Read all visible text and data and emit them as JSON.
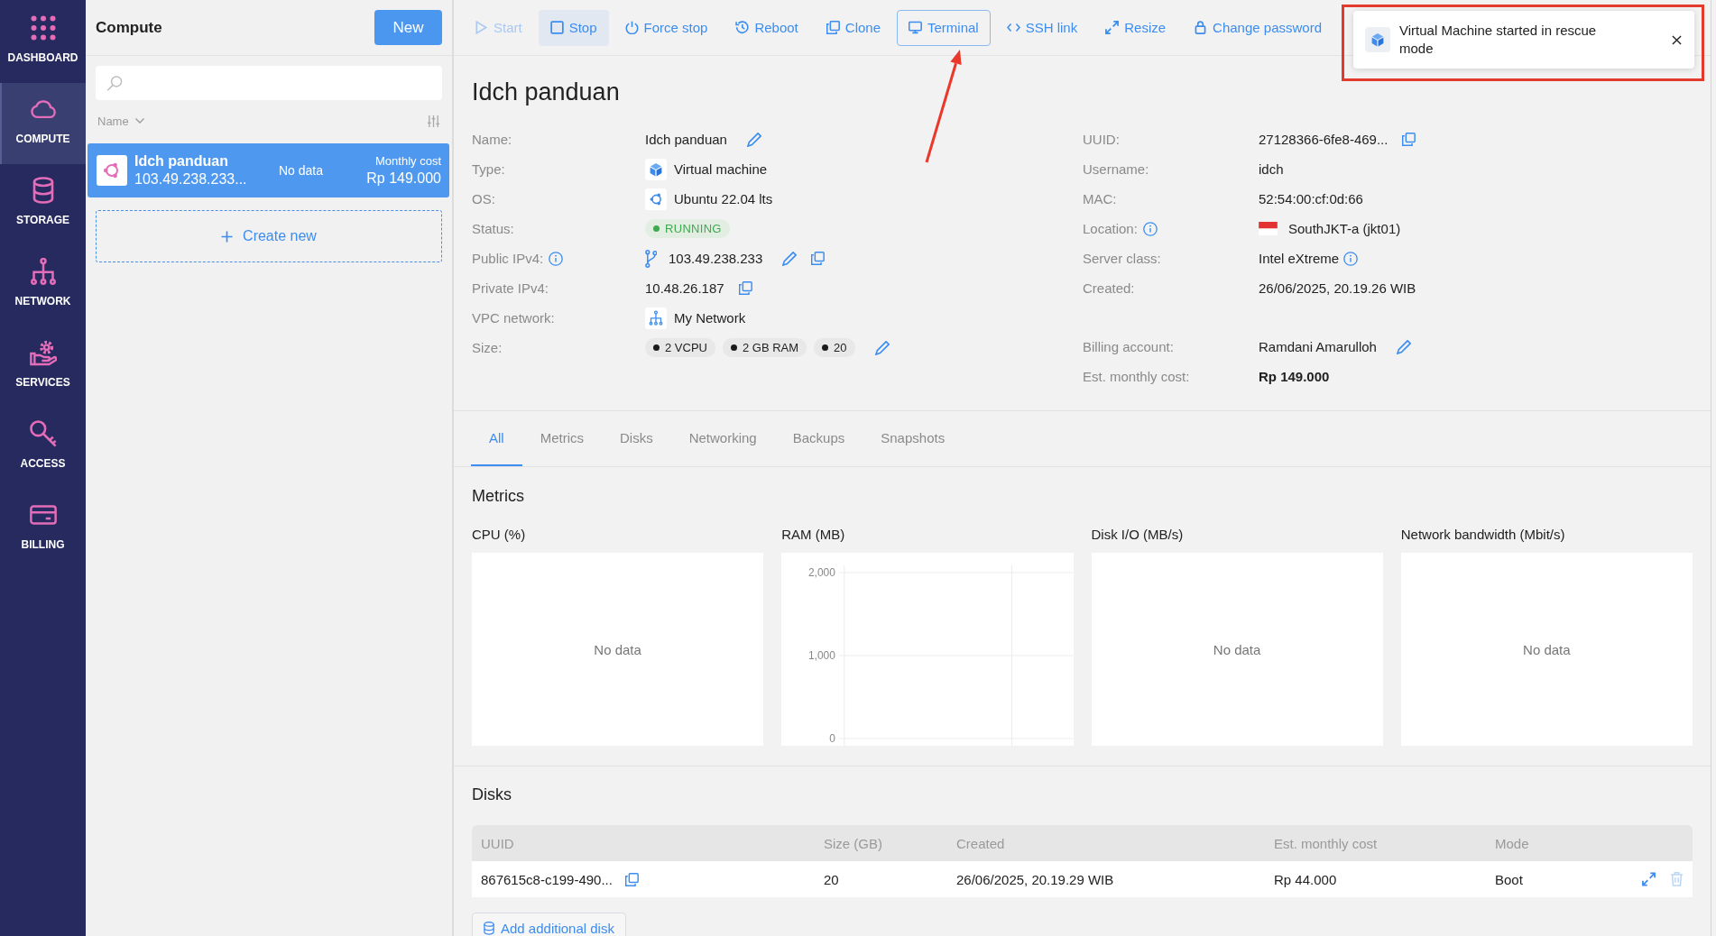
{
  "nav": [
    {
      "label": "DASHBOARD",
      "selected": false
    },
    {
      "label": "COMPUTE",
      "selected": true
    },
    {
      "label": "STORAGE",
      "selected": false
    },
    {
      "label": "NETWORK",
      "selected": false
    },
    {
      "label": "SERVICES",
      "selected": false
    },
    {
      "label": "ACCESS",
      "selected": false
    },
    {
      "label": "BILLING",
      "selected": false
    }
  ],
  "compute_panel": {
    "title": "Compute",
    "new_button": "New",
    "sort_label": "Name",
    "instances": [
      {
        "name": "Idch panduan",
        "address": "103.49.238.233...",
        "metrics": "No data",
        "cost_label": "Monthly cost",
        "cost": "Rp 149.000",
        "selected": true
      }
    ],
    "create_new": "Create new"
  },
  "toolbar": [
    {
      "label": "Start",
      "disabled": true,
      "hovered": false,
      "focused": false
    },
    {
      "label": "Stop",
      "disabled": false,
      "hovered": true,
      "focused": false
    },
    {
      "label": "Force stop",
      "disabled": false,
      "hovered": false,
      "focused": false
    },
    {
      "label": "Reboot",
      "disabled": false,
      "hovered": false,
      "focused": false
    },
    {
      "label": "Clone",
      "disabled": false,
      "hovered": false,
      "focused": false
    },
    {
      "label": "Terminal",
      "disabled": false,
      "hovered": false,
      "focused": true
    },
    {
      "label": "SSH link",
      "disabled": false,
      "hovered": false,
      "focused": false
    },
    {
      "label": "Resize",
      "disabled": false,
      "hovered": false,
      "focused": false
    },
    {
      "label": "Change password",
      "disabled": false,
      "hovered": false,
      "focused": false
    }
  ],
  "notification": {
    "message": "Virtual Machine started in rescue mode"
  },
  "instance": {
    "title": "Idch panduan",
    "details_left": [
      {
        "label": "Name:",
        "value": "Idch panduan",
        "kind": "plain",
        "label_info": false,
        "value_info": false,
        "editable": true,
        "copyable": false
      },
      {
        "label": "Type:",
        "value": "Virtual machine",
        "kind": "vm",
        "label_info": false,
        "value_info": false,
        "editable": false,
        "copyable": false
      },
      {
        "label": "OS:",
        "value": "Ubuntu 22.04 lts",
        "kind": "os",
        "label_info": false,
        "value_info": false,
        "editable": false,
        "copyable": false
      },
      {
        "label": "Status:",
        "value": "RUNNING",
        "kind": "status",
        "label_info": false,
        "value_info": false,
        "editable": false,
        "copyable": false
      },
      {
        "label": "Public IPv4:",
        "value": "103.49.238.233",
        "kind": "ip",
        "label_info": true,
        "value_info": false,
        "editable": true,
        "copyable": true
      },
      {
        "label": "Private IPv4:",
        "value": "10.48.26.187",
        "kind": "plain",
        "label_info": false,
        "value_info": false,
        "editable": false,
        "copyable": true
      },
      {
        "label": "VPC network:",
        "value": "My Network",
        "kind": "network",
        "label_info": false,
        "value_info": false,
        "editable": false,
        "copyable": false
      },
      {
        "label": "Size:",
        "chips": [
          "2 VCPU",
          "2 GB RAM",
          "20"
        ],
        "kind": "chips",
        "label_info": false,
        "value_info": false,
        "editable": true,
        "copyable": false
      }
    ],
    "details_right": [
      {
        "label": "UUID:",
        "value": "27128366-6fe8-469...",
        "kind": "plain",
        "label_info": false,
        "value_info": false,
        "editable": false,
        "copyable": true
      },
      {
        "label": "Username:",
        "value": "idch",
        "kind": "plain",
        "label_info": false,
        "value_info": false,
        "editable": false,
        "copyable": false
      },
      {
        "label": "MAC:",
        "value": "52:54:00:cf:0d:66",
        "kind": "plain",
        "label_info": false,
        "value_info": false,
        "editable": false,
        "copyable": false
      },
      {
        "label": "Location:",
        "value": "SouthJKT-a (jkt01)",
        "kind": "flag",
        "label_info": true,
        "value_info": false,
        "editable": false,
        "copyable": false
      },
      {
        "label": "Server class:",
        "value": "Intel eXtreme",
        "kind": "plain",
        "label_info": false,
        "value_info": true,
        "editable": false,
        "copyable": false
      },
      {
        "label": "Created:",
        "value": "26/06/2025, 20.19.26 WIB",
        "kind": "plain",
        "label_info": false,
        "value_info": false,
        "editable": false,
        "copyable": false
      }
    ],
    "billing": [
      {
        "label": "Billing account:",
        "value": "Ramdani Amarulloh",
        "kind": "plain",
        "label_info": false,
        "value_info": false,
        "editable": true,
        "copyable": false
      },
      {
        "label": "Est. monthly cost:",
        "value": "Rp 149.000",
        "kind": "strong",
        "label_info": false,
        "value_info": false,
        "editable": false,
        "copyable": false
      }
    ]
  },
  "tabs": [
    {
      "label": "All",
      "selected": true
    },
    {
      "label": "Metrics",
      "selected": false
    },
    {
      "label": "Disks",
      "selected": false
    },
    {
      "label": "Networking",
      "selected": false
    },
    {
      "label": "Backups",
      "selected": false
    },
    {
      "label": "Snapshots",
      "selected": false
    }
  ],
  "metrics": {
    "title": "Metrics",
    "charts": [
      {
        "title": "CPU (%)",
        "kind": "empty",
        "empty_text": "No data"
      },
      {
        "title": "RAM (MB)",
        "kind": "axes",
        "axis_labels": [
          "2,000",
          "1,000",
          "0"
        ]
      },
      {
        "title": "Disk I/O (MB/s)",
        "kind": "empty",
        "empty_text": "No data"
      },
      {
        "title": "Network bandwidth (Mbit/s)",
        "kind": "empty",
        "empty_text": "No data"
      }
    ]
  },
  "disks": {
    "title": "Disks",
    "columns": [
      "UUID",
      "Size (GB)",
      "Created",
      "Est. monthly cost",
      "Mode"
    ],
    "rows": [
      {
        "cells": [
          "867615c8-c199-490...",
          "20",
          "26/06/2025, 20.19.29 WIB",
          "Rp 44.000",
          "Boot"
        ],
        "delete_disabled": true
      }
    ],
    "add_button": "Add additional disk"
  }
}
